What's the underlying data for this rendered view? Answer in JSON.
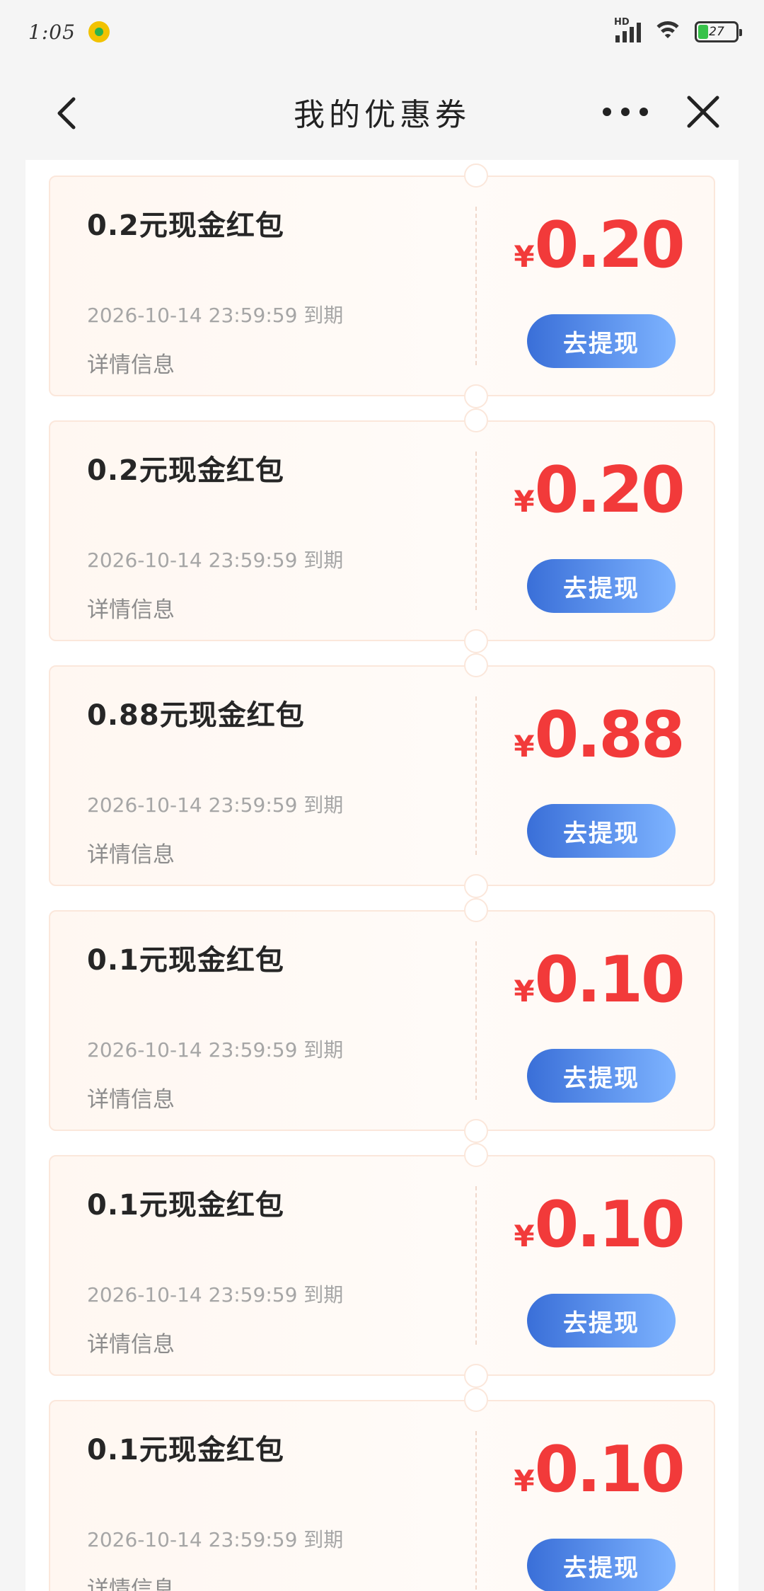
{
  "status_bar": {
    "time": "1:05",
    "network": "HD",
    "battery": "27",
    "battery_level_percent": 27
  },
  "nav": {
    "title": "我的优惠券",
    "icons": [
      "back-icon",
      "more-icon",
      "close-icon"
    ]
  },
  "colors": {
    "amount_red": "#f23a3a",
    "button_blue_start": "#3a6fd8",
    "button_blue_end": "#7db3ff"
  },
  "coupons": [
    {
      "title": "0.2元现金红包",
      "expiry": "2026-10-14 23:59:59 到期",
      "details": "详情信息",
      "currency": "¥",
      "amount": "0.20",
      "button": "去提现"
    },
    {
      "title": "0.2元现金红包",
      "expiry": "2026-10-14 23:59:59 到期",
      "details": "详情信息",
      "currency": "¥",
      "amount": "0.20",
      "button": "去提现"
    },
    {
      "title": "0.88元现金红包",
      "expiry": "2026-10-14 23:59:59 到期",
      "details": "详情信息",
      "currency": "¥",
      "amount": "0.88",
      "button": "去提现"
    },
    {
      "title": "0.1元现金红包",
      "expiry": "2026-10-14 23:59:59 到期",
      "details": "详情信息",
      "currency": "¥",
      "amount": "0.10",
      "button": "去提现"
    },
    {
      "title": "0.1元现金红包",
      "expiry": "2026-10-14 23:59:59 到期",
      "details": "详情信息",
      "currency": "¥",
      "amount": "0.10",
      "button": "去提现"
    },
    {
      "title": "0.1元现金红包",
      "expiry": "2026-10-14 23:59:59 到期",
      "details": "详情信息",
      "currency": "¥",
      "amount": "0.10",
      "button": "去提现"
    }
  ]
}
